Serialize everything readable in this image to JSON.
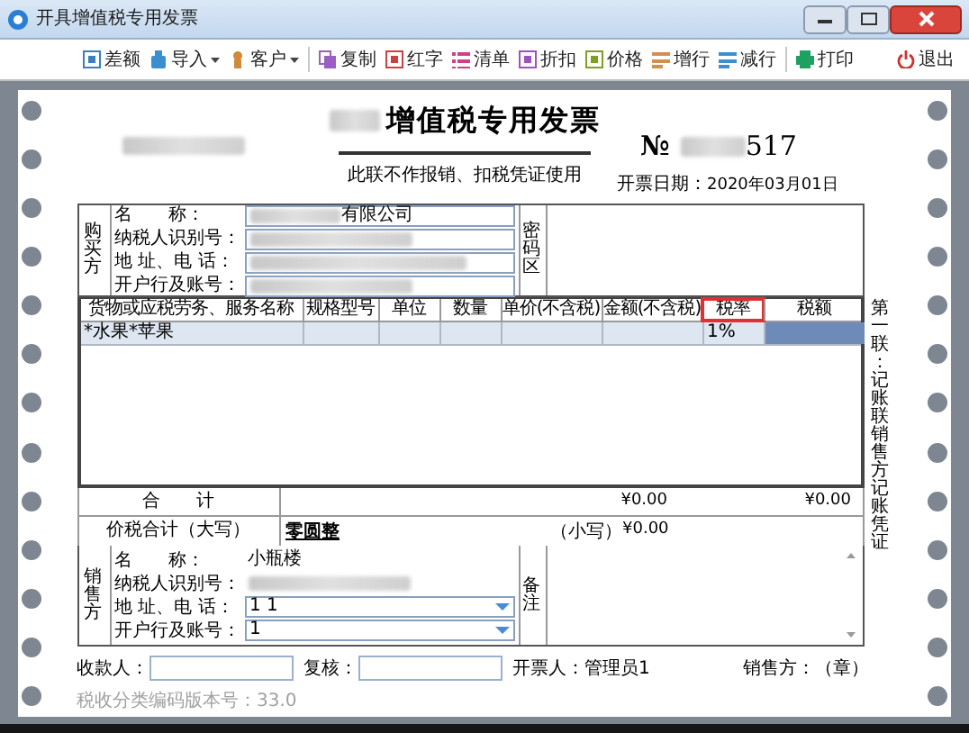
{
  "window": {
    "title": "开具增值税专用发票"
  },
  "toolbar": [
    {
      "label": "差额",
      "kind": "frame",
      "color": "#3a7fc4",
      "dropdown": false
    },
    {
      "label": "导入",
      "kind": "bottle",
      "color": "#3a8fd0",
      "dropdown": true
    },
    {
      "label": "客户",
      "kind": "person",
      "color": "#d08a3a",
      "dropdown": true
    },
    {
      "label": "复制",
      "kind": "copy",
      "color": "#9a5fc0",
      "dropdown": false
    },
    {
      "label": "红字",
      "kind": "frame",
      "color": "#d04040",
      "dropdown": false
    },
    {
      "label": "清单",
      "kind": "list",
      "color": "#d0408a",
      "dropdown": false
    },
    {
      "label": "折扣",
      "kind": "frame",
      "color": "#a050c0",
      "dropdown": false
    },
    {
      "label": "价格",
      "kind": "frame",
      "color": "#7ea020",
      "dropdown": false
    },
    {
      "label": "增行",
      "kind": "rows",
      "color": "#d09050",
      "dropdown": false
    },
    {
      "label": "减行",
      "kind": "rows",
      "color": "#3a8fd0",
      "dropdown": false
    },
    {
      "label": "打印",
      "kind": "printer",
      "color": "#20a060",
      "dropdown": false
    },
    {
      "label": "退出",
      "kind": "power",
      "color": "#d03030",
      "dropdown": false
    }
  ],
  "invoice": {
    "title": "增值税专用发票",
    "number_prefix": "№",
    "number": "517",
    "notice": "此联不作报销、扣税凭证使用",
    "date_label": "开票日期：",
    "date": "2020年03月01日"
  },
  "buyer": {
    "side_label": "购买方",
    "cipher_label": "密码区",
    "fields": [
      {
        "label": "名　　称：",
        "value": "有限公司",
        "redacted": true
      },
      {
        "label": "纳税人识别号：",
        "redacted": true
      },
      {
        "label": "地 址、电 话：",
        "redacted": true
      },
      {
        "label": "开户行及账号：",
        "redacted": true
      }
    ]
  },
  "items": {
    "columns": [
      {
        "label": "货物或应税劳务、服务名称",
        "highlighted": false
      },
      {
        "label": "规格型号",
        "highlighted": false
      },
      {
        "label": "单位",
        "highlighted": false
      },
      {
        "label": "数量",
        "highlighted": false
      },
      {
        "label": "单价(不含税)",
        "highlighted": false
      },
      {
        "label": "金额(不含税)",
        "highlighted": false
      },
      {
        "label": "税率",
        "highlighted": true
      },
      {
        "label": "税额",
        "highlighted": false
      }
    ],
    "rows": [
      {
        "cells": [
          {
            "text": "*水果*苹果",
            "selected": false
          },
          {
            "selected": false
          },
          {
            "selected": false
          },
          {
            "selected": false
          },
          {
            "selected": false
          },
          {
            "selected": false
          },
          {
            "text": "1%",
            "selected": false
          },
          {
            "selected": true
          }
        ]
      }
    ]
  },
  "totals": {
    "label": "合　　计",
    "amount": "¥0.00",
    "tax": "¥0.00"
  },
  "grand_total": {
    "label": "价税合计（大写）",
    "words": "零圆整",
    "figures_label": "（小写）",
    "figures": "¥0.00"
  },
  "seller": {
    "side_label": "销售方",
    "remarks_label": "备注",
    "fields": [
      {
        "label": "名　　称：",
        "value": "小瓶楼",
        "kind": "text",
        "redacted": false
      },
      {
        "label": "纳税人识别号：",
        "kind": "text",
        "redacted": true
      },
      {
        "label": "地 址、电 话：",
        "value": "1 1",
        "kind": "dropdown",
        "redacted": false
      },
      {
        "label": "开户行及账号：",
        "value": "1",
        "kind": "dropdown",
        "redacted": false
      }
    ]
  },
  "signatures": [
    {
      "label": "收款人：",
      "kind": "input"
    },
    {
      "label": "复核：",
      "kind": "input"
    },
    {
      "label": "开票人：",
      "value": "管理员1",
      "kind": "text"
    },
    {
      "label": "销售方：（章）",
      "kind": "text"
    }
  ],
  "copy_label": "第一联：记账联销售方记账凭证",
  "footer": "税收分类编码版本号：33.0"
}
